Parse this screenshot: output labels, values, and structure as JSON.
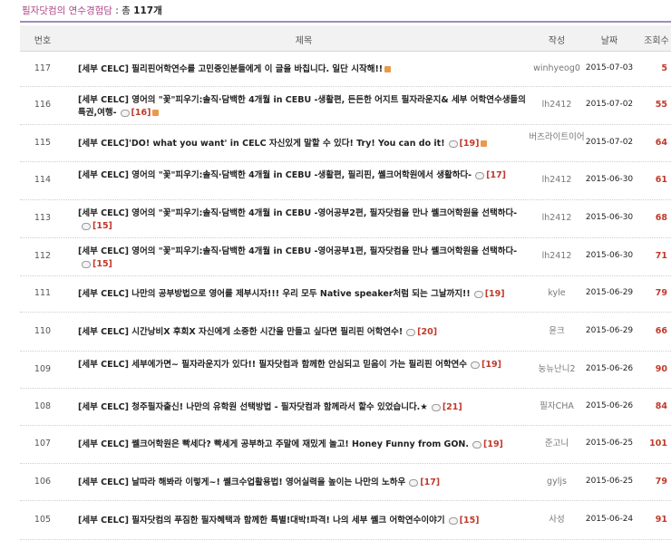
{
  "board": {
    "category": "필자닷컴의 연수경험담",
    "count_prefix": " : 총 ",
    "count": "117개"
  },
  "columns": {
    "num": "번호",
    "title": "제목",
    "author": "작성",
    "date": "날짜",
    "views": "조회수"
  },
  "rows": [
    {
      "num": "117",
      "title": "[세부 CELC] 필리핀어학연수를 고민중인분들에게 이 글을 바칩니다. 일단 시작해!!",
      "comments": "",
      "author": "winhyeog0",
      "date": "2015-07-03",
      "views": "5"
    },
    {
      "num": "116",
      "title": "[세부 CELC] 영어의 \"꽃\"피우기:솔직·담백한 4개월 in CEBU -생활편, 든든한 어지트 필자라운지& 세부 어학연수생들의 특권,여행-",
      "comments": "[16]",
      "author": "lh2412",
      "date": "2015-07-02",
      "views": "55"
    },
    {
      "num": "115",
      "title": "[세부 CELC]'DO! what you want' in CELC 자신있게 말할 수 있다! Try! You can do it!",
      "comments": "[19]",
      "author": "버즈라이트이어",
      "date": "2015-07-02",
      "views": "64"
    },
    {
      "num": "114",
      "title": "[세부 CELC] 영어의 \"꽃\"피우기:솔직·담백한 4개월 in CEBU -생활편, 필리핀, 쎌크어학원에서 생활하다-",
      "comments": "[17]",
      "author": "lh2412",
      "date": "2015-06-30",
      "views": "61"
    },
    {
      "num": "113",
      "title": "[세부 CELC] 영어의 \"꽃\"피우기:솔직·담백한 4개월 in CEBU -영어공부2편, 필자닷컴을 만나 쎌크어학원을 선택하다-",
      "comments": "[15]",
      "author": "lh2412",
      "date": "2015-06-30",
      "views": "68"
    },
    {
      "num": "112",
      "title": "[세부 CELC] 영어의 \"꽃\"피우기:솔직·담백한 4개월 in CEBU -영어공부1편, 필자닷컴을 만나 쎌크어학원을 선택하다-",
      "comments": "[15]",
      "author": "lh2412",
      "date": "2015-06-30",
      "views": "71"
    },
    {
      "num": "111",
      "title": "[세부 CELC] 나만의 공부방법으로 영어를 제부시자!!! 우리 모두 Native speaker처럼 되는 그날까지!!",
      "comments": "[19]",
      "author": "kyle",
      "date": "2015-06-29",
      "views": "79"
    },
    {
      "num": "110",
      "title": "[세부 CELC] 시간낭비X 후회X 자신에게 소중한 시간을 만들고 싶다면 필리핀 어학연수!",
      "comments": "[20]",
      "author": "윤크",
      "date": "2015-06-29",
      "views": "66"
    },
    {
      "num": "109",
      "title": "[세부 CELC] 세부에가면~ 필자라운지가 있다!! 필자닷컴과 함께한 안심되고 믿음이 가는 필리핀 어학연수",
      "comments": "[19]",
      "author": "눙뉴난니2",
      "date": "2015-06-26",
      "views": "90"
    },
    {
      "num": "108",
      "title": "[세부 CELC] 청주필자출신! 나만의 유학원 선택방법 - 필자닷컴과 함께라서 할수 있었습니다.★",
      "comments": "[21]",
      "author": "필자CHA",
      "date": "2015-06-26",
      "views": "84"
    },
    {
      "num": "107",
      "title": "[세부 CELC] 쎌크어학원은 빡세다? 빡세게 공부하고 주말에 재밌게 놀고! Honey Funny from GON.",
      "comments": "[19]",
      "author": "준고니",
      "date": "2015-06-25",
      "views": "101"
    },
    {
      "num": "106",
      "title": "[세부 CELC] 날따라 해봐라 이렇게~! 쎌크수업활용법! 영어실력을 높이는 나만의 노하우",
      "comments": "[17]",
      "author": "gyljs",
      "date": "2015-06-25",
      "views": "79"
    },
    {
      "num": "105",
      "title": "[세부 CELC] 필자닷컴의 푸짐한 필자혜택과 함께한 특별!대박!파격! 나의 세부 쎌크 어학연수이야기",
      "comments": "[15]",
      "author": "사성",
      "date": "2015-06-24",
      "views": "91"
    }
  ]
}
